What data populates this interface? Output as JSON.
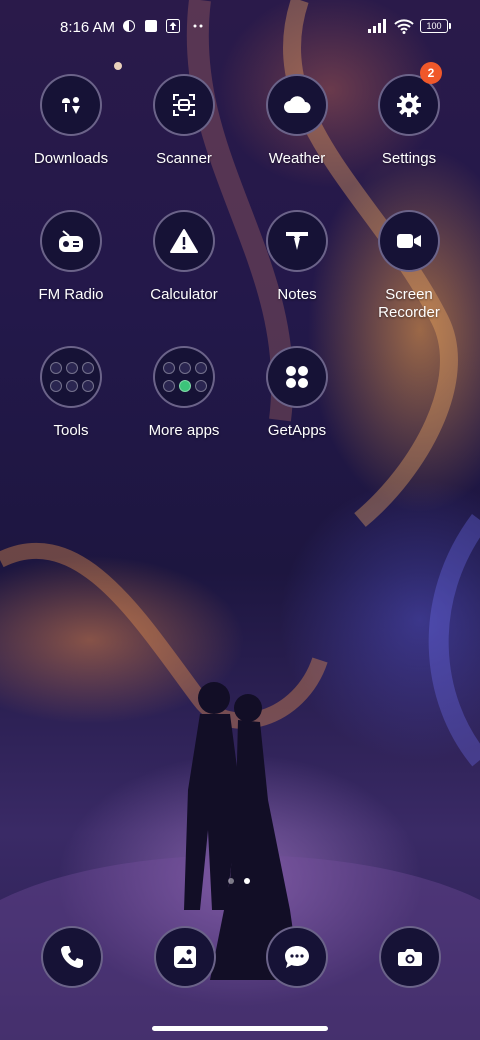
{
  "status_bar": {
    "time": "8:16 AM",
    "battery": "100"
  },
  "apps": {
    "downloads": "Downloads",
    "scanner": "Scanner",
    "weather": "Weather",
    "settings": "Settings",
    "settings_badge": "2",
    "fm_radio": "FM Radio",
    "calculator": "Calculator",
    "notes": "Notes",
    "screen_recorder_1": "Screen",
    "screen_recorder_2": "Recorder",
    "tools": "Tools",
    "more_apps": "More apps",
    "getapps": "GetApps"
  },
  "page_indicator": {
    "pages": 2,
    "active": 2
  },
  "dock": [
    "phone-icon",
    "gallery-icon",
    "messages-icon",
    "camera-icon"
  ],
  "colors": {
    "badge": "#f0582a",
    "icon_bg": "#161236"
  }
}
